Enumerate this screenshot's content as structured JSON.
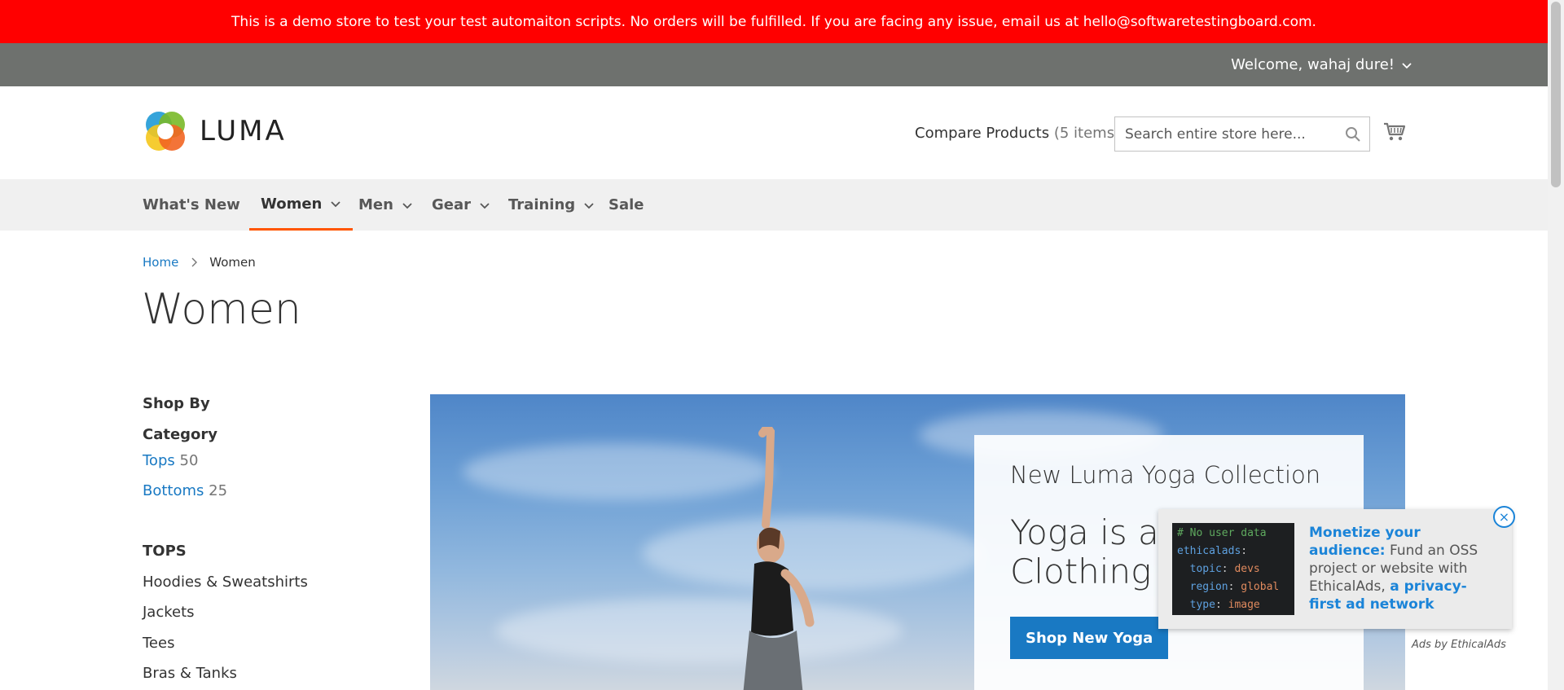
{
  "demo_banner": {
    "text": "This is a demo store to test your test automaiton scripts. No orders will be fulfilled. If you are facing any issue, email us at hello@softwaretestingboard.com."
  },
  "header_panel": {
    "welcome": "Welcome, wahaj dure!"
  },
  "header": {
    "logo_text": "LUMA",
    "compare_label": "Compare Products",
    "compare_count": "(5 items)",
    "search_placeholder": "Search entire store here..."
  },
  "nav": {
    "items": [
      {
        "label": "What's New",
        "has_dropdown": false,
        "active": false
      },
      {
        "label": "Women",
        "has_dropdown": true,
        "active": true
      },
      {
        "label": "Men",
        "has_dropdown": true,
        "active": false
      },
      {
        "label": "Gear",
        "has_dropdown": true,
        "active": false
      },
      {
        "label": "Training",
        "has_dropdown": true,
        "active": false
      },
      {
        "label": "Sale",
        "has_dropdown": false,
        "active": false
      }
    ]
  },
  "breadcrumb": {
    "home": "Home",
    "current": "Women"
  },
  "page_title": "Women",
  "sidebar": {
    "shop_by": "Shop By",
    "category_title": "Category",
    "categories": [
      {
        "label": "Tops",
        "count": "50"
      },
      {
        "label": "Bottoms",
        "count": "25"
      }
    ],
    "tops_title": "TOPS",
    "tops_items": [
      "Hoodies & Sweatshirts",
      "Jackets",
      "Tees",
      "Bras & Tanks"
    ]
  },
  "hero": {
    "subtitle": "New Luma Yoga Collection",
    "headline": "Yoga is ancient Clothing sh",
    "button": "Shop New Yoga"
  },
  "ad": {
    "code_lines": [
      {
        "text": "# No user data",
        "color": "#5faa5f"
      },
      {
        "key": "ethicalads",
        "value": ""
      },
      {
        "key": "  topic",
        "value": "devs"
      },
      {
        "key": "  region",
        "value": "global"
      },
      {
        "key": "  type",
        "value": "image"
      }
    ],
    "headline": "Monetize your audience:",
    "body": "Fund an OSS project or website with EthicalAds,",
    "link": "a privacy-first ad network",
    "close": "×",
    "attribution": "Ads by EthicalAds"
  },
  "colors": {
    "banner": "#ff0000",
    "panel": "#6e716e",
    "link": "#1979c3",
    "active_underline": "#ff5501"
  }
}
